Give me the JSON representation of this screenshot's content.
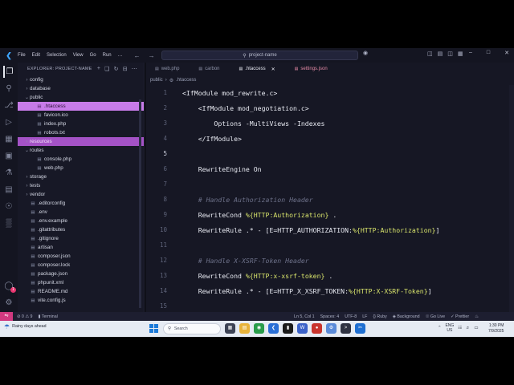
{
  "titlebar": {
    "menu": [
      "File",
      "Edit",
      "Selection",
      "View",
      "Go",
      "Run",
      "…"
    ],
    "search_text": "project-name"
  },
  "sidebar": {
    "header": "EXPLORER: PROJECT-NAME",
    "items": [
      {
        "label": "config",
        "kind": "folder",
        "indent": 1,
        "expanded": false
      },
      {
        "label": "database",
        "kind": "folder",
        "indent": 1,
        "expanded": false
      },
      {
        "label": "public",
        "kind": "folder",
        "indent": 1,
        "expanded": true
      },
      {
        "label": ".htaccess",
        "kind": "file",
        "indent": 2,
        "state": "selected"
      },
      {
        "label": "favicon.ico",
        "kind": "file",
        "indent": 2
      },
      {
        "label": "index.php",
        "kind": "file",
        "indent": 2
      },
      {
        "label": "robots.txt",
        "kind": "file",
        "indent": 2
      },
      {
        "label": "resources",
        "kind": "folder",
        "indent": 1,
        "expanded": false,
        "state": "hover"
      },
      {
        "label": "routes",
        "kind": "folder",
        "indent": 1,
        "expanded": true
      },
      {
        "label": "console.php",
        "kind": "file",
        "indent": 2
      },
      {
        "label": "web.php",
        "kind": "file",
        "indent": 2
      },
      {
        "label": "storage",
        "kind": "folder",
        "indent": 1,
        "expanded": false
      },
      {
        "label": "tests",
        "kind": "folder",
        "indent": 1,
        "expanded": false
      },
      {
        "label": "vendor",
        "kind": "folder",
        "indent": 1,
        "expanded": false
      },
      {
        "label": ".editorconfig",
        "kind": "file",
        "indent": 1
      },
      {
        "label": ".env",
        "kind": "file",
        "indent": 1
      },
      {
        "label": ".env.example",
        "kind": "file",
        "indent": 1
      },
      {
        "label": ".gitattributes",
        "kind": "file",
        "indent": 1
      },
      {
        "label": ".gitignore",
        "kind": "file",
        "indent": 1
      },
      {
        "label": "artisan",
        "kind": "file",
        "indent": 1
      },
      {
        "label": "composer.json",
        "kind": "file",
        "indent": 1
      },
      {
        "label": "composer.lock",
        "kind": "file",
        "indent": 1
      },
      {
        "label": "package.json",
        "kind": "file",
        "indent": 1
      },
      {
        "label": "phpunit.xml",
        "kind": "file",
        "indent": 1
      },
      {
        "label": "README.md",
        "kind": "file",
        "indent": 1
      },
      {
        "label": "vite.config.js",
        "kind": "file",
        "indent": 1
      }
    ]
  },
  "editor": {
    "tabs": [
      {
        "label": "web.php",
        "state": "inactive"
      },
      {
        "label": "carbon",
        "state": "inactive"
      },
      {
        "label": ".htaccess",
        "state": "active"
      },
      {
        "label": "settings.json",
        "state": "modified"
      }
    ],
    "breadcrumb": [
      "public",
      ".htaccess"
    ],
    "current_line": 5,
    "lines": [
      {
        "n": "1",
        "segments": [
          {
            "t": "<IfModule mod_rewrite.c>",
            "c": "plain"
          }
        ]
      },
      {
        "n": "2",
        "segments": [
          {
            "t": "    <IfModule mod_negotiation.c>",
            "c": "plain"
          }
        ]
      },
      {
        "n": "3",
        "segments": [
          {
            "t": "        Options -MultiViews -Indexes",
            "c": "plain"
          }
        ]
      },
      {
        "n": "4",
        "segments": [
          {
            "t": "    </IfModule>",
            "c": "plain"
          }
        ]
      },
      {
        "n": "5",
        "segments": []
      },
      {
        "n": "6",
        "segments": [
          {
            "t": "    RewriteEngine On",
            "c": "plain"
          }
        ]
      },
      {
        "n": "7",
        "segments": []
      },
      {
        "n": "8",
        "segments": [
          {
            "t": "    # Handle Authorization Header",
            "c": "comment"
          }
        ]
      },
      {
        "n": "9",
        "segments": [
          {
            "t": "    RewriteCond ",
            "c": "plain"
          },
          {
            "t": "%{HTTP:Authorization}",
            "c": "var"
          },
          {
            "t": " .",
            "c": "plain"
          }
        ]
      },
      {
        "n": "10",
        "segments": [
          {
            "t": "    RewriteRule .* - [E=HTTP_AUTHORIZATION:",
            "c": "plain"
          },
          {
            "t": "%{HTTP:Authorization}",
            "c": "var"
          },
          {
            "t": "]",
            "c": "plain"
          }
        ]
      },
      {
        "n": "11",
        "segments": []
      },
      {
        "n": "12",
        "segments": [
          {
            "t": "    # Handle X-XSRF-Token Header",
            "c": "comment"
          }
        ]
      },
      {
        "n": "13",
        "segments": [
          {
            "t": "    RewriteCond ",
            "c": "plain"
          },
          {
            "t": "%{HTTP:x-xsrf-token}",
            "c": "var"
          },
          {
            "t": " .",
            "c": "plain"
          }
        ]
      },
      {
        "n": "14",
        "segments": [
          {
            "t": "    RewriteRule .* - [E=HTTP_X_XSRF_TOKEN:",
            "c": "plain"
          },
          {
            "t": "%{HTTP:X-XSRF-Token}",
            "c": "var"
          },
          {
            "t": "]",
            "c": "plain"
          }
        ]
      },
      {
        "n": "15",
        "segments": []
      }
    ]
  },
  "statusbar": {
    "problems": "⊘ 0 ⚠ 9",
    "terminal": "Terminal",
    "position": "Ln 5, Col 1",
    "spaces": "Spaces: 4",
    "encoding": "UTF-8",
    "eol": "LF",
    "language": "{} Ruby",
    "background": "Background",
    "golive": "Go Live",
    "prettier": "Prettier"
  },
  "taskbar": {
    "weather_line1": "Rainy days ahead",
    "weather_line2": "",
    "search_placeholder": "Search",
    "lang_line1": "ENG",
    "lang_line2": "US",
    "time": "1:30 PM",
    "date": "7/9/2025"
  },
  "colors": {
    "accent": "#c77be8",
    "hover": "#a452c6",
    "variable": "#d7e36b",
    "comment": "#6c7088",
    "remote": "#d0397f"
  }
}
